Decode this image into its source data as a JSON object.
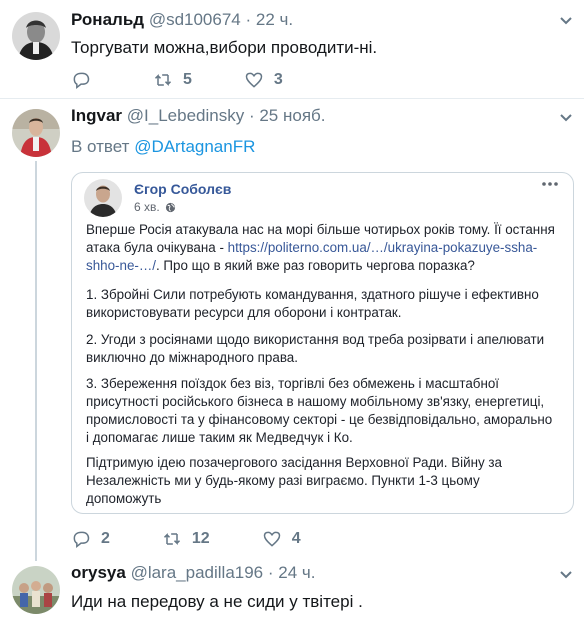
{
  "tweets": [
    {
      "name": "Рональд",
      "handle": "@sd100674",
      "time": "· 22 ч.",
      "text": "Торгувати можна,вибори проводити-ні.",
      "reply_count": "",
      "retweet_count": "5",
      "like_count": "3"
    },
    {
      "name": "Ingvar",
      "handle": "@I_Lebedinsky",
      "time": "· 25 нояб.",
      "reply_prefix": "В ответ",
      "reply_mention": "@DArtagnanFR",
      "reply_count": "2",
      "retweet_count": "12",
      "like_count": "4"
    },
    {
      "name": "orysya",
      "handle": "@lara_padilla196",
      "time": "· 24 ч.",
      "text": "Иди на передову а не сиди у твітері ."
    }
  ],
  "fb_post": {
    "author": "Єгор Соболєв",
    "time": "6 хв.",
    "p1_lines": [
      "Вперше Росія атакувала нас на морі більше чотирьох років тому. Її остання",
      "атака була очікувана - "
    ],
    "p1_link": "https://politerno.com.ua/…/ukrayina-pokazuye-ssha-",
    "p1_link2": "shho-ne-…/",
    "p1_tail": ". Про що в який вже раз говорить чергова поразка?",
    "p2_lines": [
      "1. Збройні Сили потребують командування, здатного рішуче і ефективно",
      "використовувати ресурси для оборони і контратак."
    ],
    "p3_lines": [
      "2. Угоди з росіянами щодо використання вод треба розірвати і апелювати",
      "виключно до міжнародного права."
    ],
    "p4_lines": [
      "3. Збереження поїздок без віз, торгівлі без обмежень і масштабної",
      "присутності російського бізнеса в нашому мобільному зв'язку, енергетиці,",
      "промисловості та у фінансовому секторі - це безвідповідально, аморально",
      "і допомагає лише таким як Медведчук і Ко."
    ],
    "p5_lines": [
      "Підтримую ідею позачергового засідання Верховної Ради. Війну за",
      "Незалежність ми у будь-якому разі виграємо. Пункти 1-3 цьому",
      "допоможуть"
    ]
  },
  "colors": {
    "accent": "#1b95e0",
    "muted": "#657786",
    "fb_link": "#385898",
    "fb_name": "#365899"
  }
}
